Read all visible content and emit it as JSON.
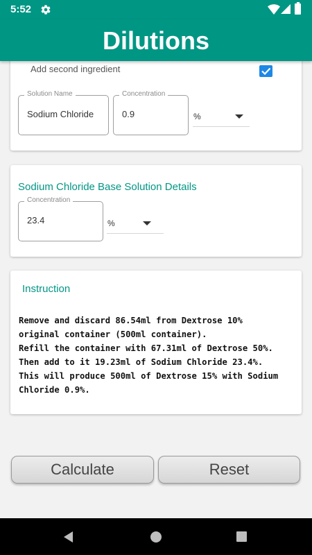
{
  "status_bar": {
    "time": "5:52"
  },
  "app_bar": {
    "title": "Dilutions"
  },
  "second_ingredient": {
    "checkbox_label": "Add second ingredient",
    "checked": true,
    "solution_name_label": "Solution Name",
    "solution_name_value": "Sodium Chloride",
    "concentration_label": "Concentration",
    "concentration_value": "0.9",
    "unit": "%"
  },
  "base_solution": {
    "title": "Sodium Chloride Base Solution Details",
    "concentration_label": "Concentration",
    "concentration_value": "23.4",
    "unit": "%"
  },
  "instruction": {
    "title": "Instruction",
    "text": "Remove and discard 86.54ml from Dextrose 10%\noriginal container (500ml container).\nRefill the container with 67.31ml of Dextrose 50%.\nThen add to it 19.23ml of Sodium Chloride 23.4%.\nThis will produce 500ml of Dextrose 15% with Sodium\nChloride 0.9%."
  },
  "buttons": {
    "calculate": "Calculate",
    "reset": "Reset"
  },
  "colors": {
    "primary": "#009684",
    "checkbox": "#1e88e5",
    "nav_bar": "#000000"
  }
}
